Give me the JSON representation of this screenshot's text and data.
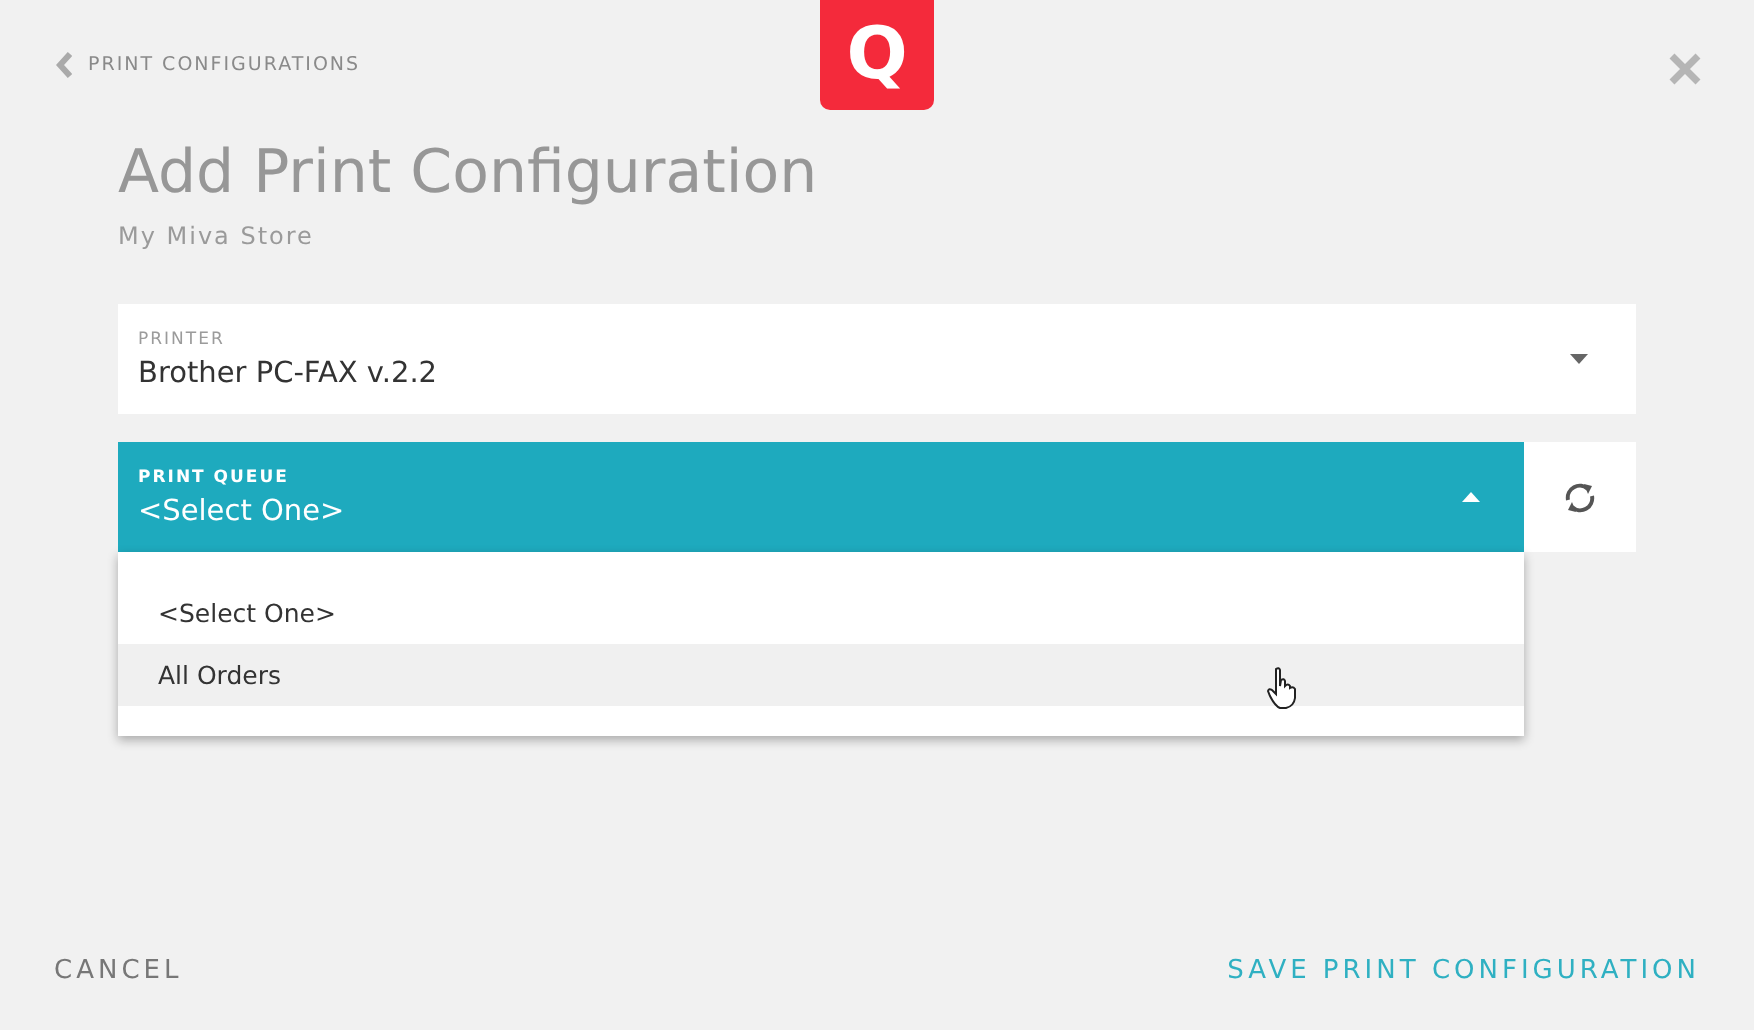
{
  "back_link": {
    "label": "PRINT CONFIGURATIONS"
  },
  "logo": {
    "letter": "Q"
  },
  "title": "Add Print Configuration",
  "subtitle": "My Miva Store",
  "printer": {
    "label": "PRINTER",
    "value": "Brother PC-FAX v.2.2",
    "expanded": false
  },
  "print_queue": {
    "label": "PRINT QUEUE",
    "value": "<Select One>",
    "expanded": true,
    "options": [
      {
        "label": "<Select One>",
        "hovered": false
      },
      {
        "label": "All Orders",
        "hovered": true
      }
    ]
  },
  "buttons": [
    {
      "label": "CANCEL",
      "kind": "secondary"
    },
    {
      "label": "SAVE PRINT CONFIGURATION",
      "kind": "primary"
    }
  ]
}
